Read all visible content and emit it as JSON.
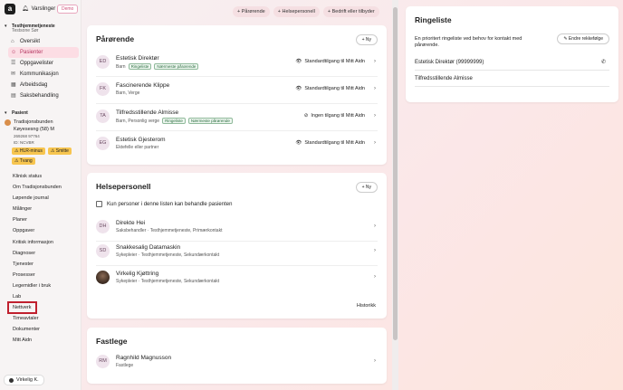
{
  "app": {
    "logo": "a",
    "notifications_label": "Varslinger",
    "demo_badge": "Demo"
  },
  "org": {
    "title": "Testhjemmetjeneste",
    "subtitle": "Testsone Sør"
  },
  "nav": [
    {
      "label": "Oversikt",
      "icon": "home-icon"
    },
    {
      "label": "Pasienter",
      "icon": "users-icon",
      "active": true
    },
    {
      "label": "Oppgavelister",
      "icon": "list-icon"
    },
    {
      "label": "Kommunikasjon",
      "icon": "chat-icon"
    },
    {
      "label": "Arbeidsdag",
      "icon": "calendar-icon"
    },
    {
      "label": "Saksbehandling",
      "icon": "folder-icon"
    }
  ],
  "patient_section": {
    "label": "Pasient",
    "name_line1": "Tradisjonsbunden",
    "name_line2": "Køyesesng (58) M",
    "dob": "269268 97764",
    "id": "ID: NCVBR",
    "alerts": [
      "HLR-minus",
      "Smitte",
      "Tvang"
    ]
  },
  "patient_menu": [
    "Klinisk status",
    "Om Tradisjonsbunden",
    "Løpende journal",
    "Målinger",
    "Planer",
    "Oppgaver",
    "Kritisk informasjon",
    "Diagnoser",
    "Tjenester",
    "Prosesser",
    "Legemidler i bruk",
    "Lab",
    "Nettverk",
    "Timeavtaler",
    "Dokumenter",
    "Mitt Aidn"
  ],
  "user": {
    "name": "Virkelig K."
  },
  "top_actions": [
    "+ Pårørende",
    "+ Helsepersonell",
    "+ Bedrift eller tilbyder"
  ],
  "parorende": {
    "title": "Pårørende",
    "new_label": "+ Ny",
    "rows": [
      {
        "initials": "ED",
        "name": "Estetisk Direktør",
        "sub": "Barn",
        "tags": [
          "Ringeliste",
          "Nærmeste pårørende"
        ],
        "access": "Standardtilgang til Mitt Aidn"
      },
      {
        "initials": "FK",
        "name": "Fascinerende Klippe",
        "sub": "Barn, Verge",
        "tags": [],
        "access": "Standardtilgang til Mitt Aidn"
      },
      {
        "initials": "TA",
        "name": "Tilfredsstillende Almisse",
        "sub": "Barn, Personlig verge",
        "tags": [
          "Ringeliste",
          "Nærmeste pårørende"
        ],
        "access": "Ingen tilgang til Mitt Aidn"
      },
      {
        "initials": "EG",
        "name": "Estetisk Gjesterom",
        "sub": "Ektefelle eller partner",
        "tags": [],
        "access": "Standardtilgang til Mitt Aidn"
      }
    ]
  },
  "helsepersonell": {
    "title": "Helsepersonell",
    "new_label": "+ Ny",
    "checkbox_label": "Kun personer i denne listen kan behandle pasienten",
    "rows": [
      {
        "initials": "DH",
        "name": "Direkte Hei",
        "sub": "Saksbehandler · Testhjemmetjeneste, Primærkontakt"
      },
      {
        "initials": "SD",
        "name": "Snakkesalig Datamaskin",
        "sub": "Sykepleier · Testhjemmetjeneste, Sekundærkontakt"
      },
      {
        "initials": "",
        "name": "Virkelig Kjøttring",
        "sub": "Sykepleier · Testhjemmetjeneste, Sekundærkontakt",
        "photo": true
      }
    ],
    "history_label": "Historikk"
  },
  "fastlege": {
    "title": "Fastlege",
    "rows": [
      {
        "initials": "RM",
        "name": "Ragnhild Magnusson",
        "sub": "Fastlege"
      }
    ]
  },
  "ringeliste": {
    "title": "Ringeliste",
    "description": "En prioritert ringeliste ved behov for kontakt med pårørende.",
    "reorder_label": "Endre rekkefølge",
    "rows": [
      {
        "label": "Estetisk Direktør (99999999)",
        "phone": true
      },
      {
        "label": "Tilfredsstillende Almisse",
        "phone": false
      }
    ]
  }
}
